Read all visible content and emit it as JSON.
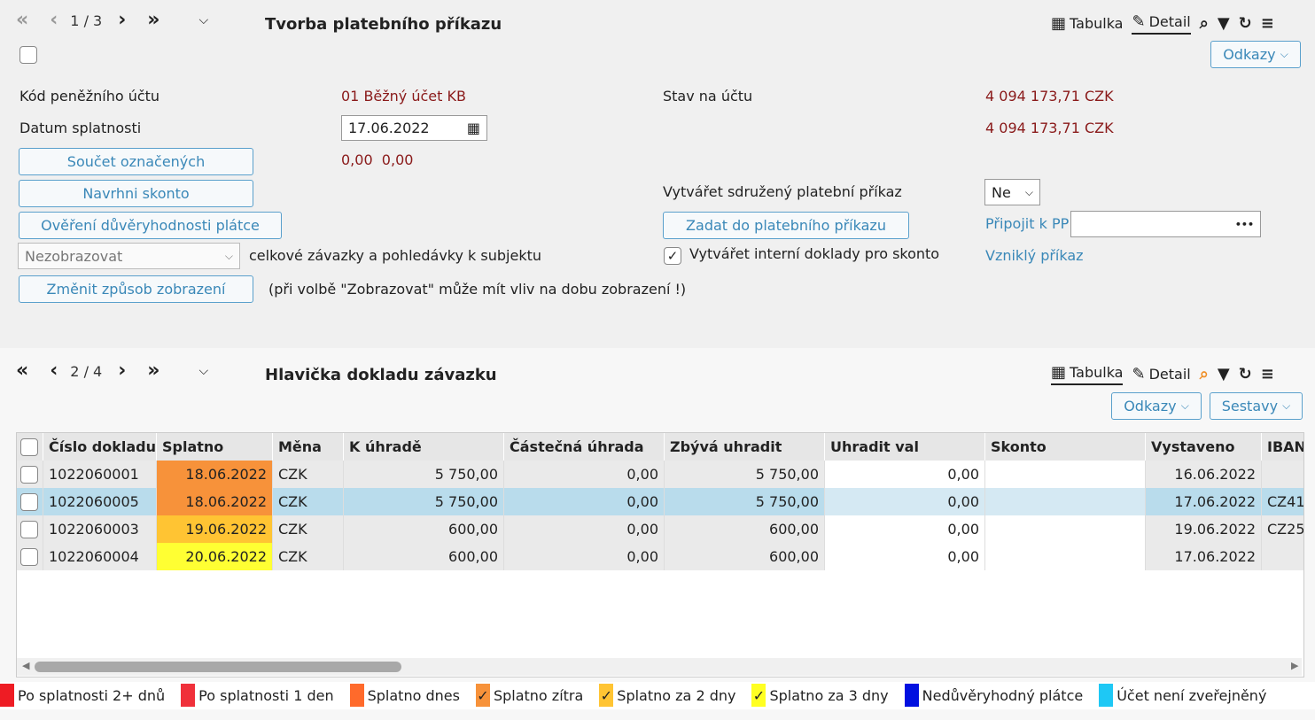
{
  "top": {
    "pager": "1 / 3",
    "title": "Tvorba platebního příkazu",
    "view_table": "Tabulka",
    "view_detail": "Detail",
    "links_btn": "Odkazy",
    "kod_label": "Kód peněžního účtu",
    "kod_value": "01 Běžný účet KB",
    "stav_label": "Stav na účtu",
    "stav_value1": "4 094 173,71 CZK",
    "stav_value2": "4 094 173,71 CZK",
    "datum_label": "Datum splatnosti",
    "datum_value": "17.06.2022",
    "soucet_btn": "Součet označených",
    "soucet_value": "0,00  0,00",
    "skonto_btn": "Navrhni skonto",
    "overeni_btn": "Ověření důvěryhodnosti plátce",
    "sdruzeny_label": "Vytvářet sdružený platební příkaz",
    "sdruzeny_value": "Ne",
    "zadat_btn": "Zadat do platebního příkazu",
    "pripojit_link": "Připojit k PP",
    "pripojit_dots": "•••",
    "zobrazeni_select": "Nezobrazovat",
    "zobrazeni_text": "celkové závazky a pohledávky k subjektu",
    "interni_label": "Vytvářet interní doklady pro skonto",
    "vznikly_link": "Vzniklý příkaz",
    "zmenit_btn": "Změnit způsob zobrazení",
    "zmenit_note": "(při volbě \"Zobrazovat\" může mít vliv na dobu zobrazení !)"
  },
  "bottom": {
    "pager": "2 / 4",
    "title": "Hlavička dokladu závazku",
    "view_table": "Tabulka",
    "view_detail": "Detail",
    "links_btn": "Odkazy",
    "reports_btn": "Sestavy",
    "columns": [
      "Číslo dokladu",
      "Splatno",
      "Měna",
      "K úhradě",
      "Částečná úhrada",
      "Zbývá uhradit",
      "Uhradit val",
      "Skonto",
      "Vystaveno",
      "IBAN"
    ],
    "rows": [
      {
        "cislo": "1022060001",
        "splatno": "18.06.2022",
        "mena": "CZK",
        "k_uhrade": "5 750,00",
        "castecna": "0,00",
        "zbyva": "5 750,00",
        "uhradit": "0,00",
        "skonto": "",
        "vystaveno": "16.06.2022",
        "iban": ""
      },
      {
        "cislo": "1022060005",
        "splatno": "18.06.2022",
        "mena": "CZK",
        "k_uhrade": "5 750,00",
        "castecna": "0,00",
        "zbyva": "5 750,00",
        "uhradit": "0,00",
        "skonto": "",
        "vystaveno": "17.06.2022",
        "iban": "CZ41"
      },
      {
        "cislo": "1022060003",
        "splatno": "19.06.2022",
        "mena": "CZK",
        "k_uhrade": "600,00",
        "castecna": "0,00",
        "zbyva": "600,00",
        "uhradit": "0,00",
        "skonto": "",
        "vystaveno": "19.06.2022",
        "iban": "CZ25"
      },
      {
        "cislo": "1022060004",
        "splatno": "20.06.2022",
        "mena": "CZK",
        "k_uhrade": "600,00",
        "castecna": "0,00",
        "zbyva": "600,00",
        "uhradit": "0,00",
        "skonto": "",
        "vystaveno": "17.06.2022",
        "iban": ""
      }
    ],
    "splatno_colors": [
      "#f7923a",
      "#f7923a",
      "#ffc433",
      "#ffff33"
    ]
  },
  "legend": [
    {
      "label": "Po splatnosti 2+ dnů",
      "color": "#ee1c24",
      "check": ""
    },
    {
      "label": "Po splatnosti 1 den",
      "color": "#f0303a",
      "check": ""
    },
    {
      "label": "Splatno dnes",
      "color": "#ff6a2b",
      "check": ""
    },
    {
      "label": "Splatno zítra",
      "color": "#f7923a",
      "check": "✓"
    },
    {
      "label": "Splatno za 2 dny",
      "color": "#ffc433",
      "check": "✓"
    },
    {
      "label": "Splatno za 3 dny",
      "color": "#ffff22",
      "check": "✓"
    },
    {
      "label": "Nedůvěryhodný plátce",
      "color": "#0010e0",
      "check": ""
    },
    {
      "label": "Účet není zveřejněný",
      "color": "#1ec8f5",
      "check": ""
    }
  ]
}
